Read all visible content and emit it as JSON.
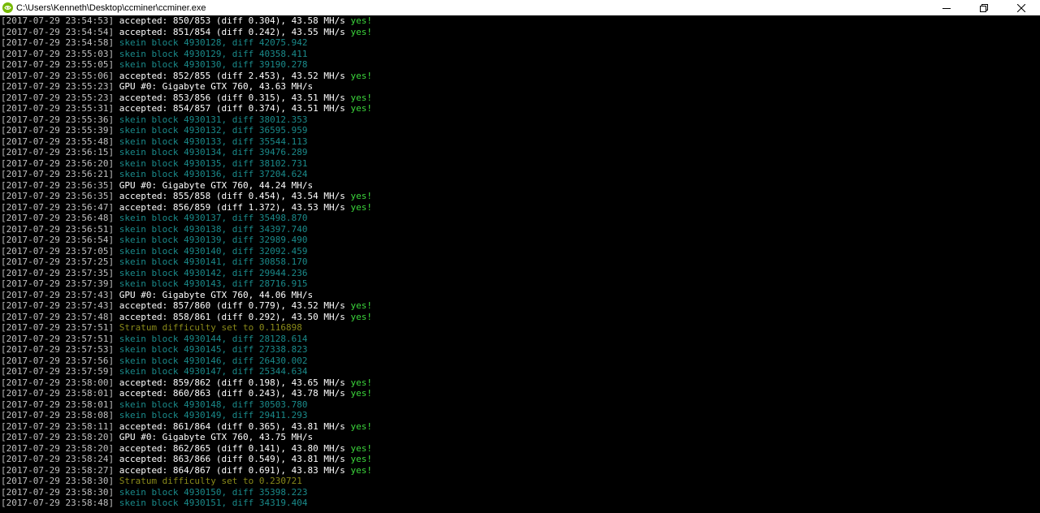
{
  "window": {
    "title": "C:\\Users\\Kenneth\\Desktop\\ccminer\\ccminer.exe"
  },
  "colors": {
    "accepted": "#ffffff",
    "block": "#1a8a8a",
    "gpu": "#ffffff",
    "stratum": "#8a8a1a",
    "yes": "#3cd73c",
    "timestamp": "#c0c0c0"
  },
  "icons": {
    "app": "nvidia-app-icon",
    "minimize": "minimize-icon",
    "restore": "restore-icon",
    "close": "close-icon"
  },
  "log": [
    {
      "ts": "[2017-07-29 23:54:53]",
      "type": "accepted",
      "text": "accepted: 850/853 (diff 0.304), 43.58 MH/s ",
      "yes": "yes!"
    },
    {
      "ts": "[2017-07-29 23:54:54]",
      "type": "accepted",
      "text": "accepted: 851/854 (diff 0.242), 43.55 MH/s ",
      "yes": "yes!"
    },
    {
      "ts": "[2017-07-29 23:54:58]",
      "type": "block",
      "text": "skein block 4930128, diff 42075.942"
    },
    {
      "ts": "[2017-07-29 23:55:03]",
      "type": "block",
      "text": "skein block 4930129, diff 40358.411"
    },
    {
      "ts": "[2017-07-29 23:55:05]",
      "type": "block",
      "text": "skein block 4930130, diff 39190.278"
    },
    {
      "ts": "[2017-07-29 23:55:06]",
      "type": "accepted",
      "text": "accepted: 852/855 (diff 2.453), 43.52 MH/s ",
      "yes": "yes!"
    },
    {
      "ts": "[2017-07-29 23:55:23]",
      "type": "gpu",
      "text": "GPU #0: Gigabyte GTX 760, 43.63 MH/s"
    },
    {
      "ts": "[2017-07-29 23:55:23]",
      "type": "accepted",
      "text": "accepted: 853/856 (diff 0.315), 43.51 MH/s ",
      "yes": "yes!"
    },
    {
      "ts": "[2017-07-29 23:55:31]",
      "type": "accepted",
      "text": "accepted: 854/857 (diff 0.374), 43.51 MH/s ",
      "yes": "yes!"
    },
    {
      "ts": "[2017-07-29 23:55:36]",
      "type": "block",
      "text": "skein block 4930131, diff 38012.353"
    },
    {
      "ts": "[2017-07-29 23:55:39]",
      "type": "block",
      "text": "skein block 4930132, diff 36595.959"
    },
    {
      "ts": "[2017-07-29 23:55:48]",
      "type": "block",
      "text": "skein block 4930133, diff 35544.113"
    },
    {
      "ts": "[2017-07-29 23:56:15]",
      "type": "block",
      "text": "skein block 4930134, diff 39476.289"
    },
    {
      "ts": "[2017-07-29 23:56:20]",
      "type": "block",
      "text": "skein block 4930135, diff 38102.731"
    },
    {
      "ts": "[2017-07-29 23:56:21]",
      "type": "block",
      "text": "skein block 4930136, diff 37204.624"
    },
    {
      "ts": "[2017-07-29 23:56:35]",
      "type": "gpu",
      "text": "GPU #0: Gigabyte GTX 760, 44.24 MH/s"
    },
    {
      "ts": "[2017-07-29 23:56:35]",
      "type": "accepted",
      "text": "accepted: 855/858 (diff 0.454), 43.54 MH/s ",
      "yes": "yes!"
    },
    {
      "ts": "[2017-07-29 23:56:47]",
      "type": "accepted",
      "text": "accepted: 856/859 (diff 1.372), 43.53 MH/s ",
      "yes": "yes!"
    },
    {
      "ts": "[2017-07-29 23:56:48]",
      "type": "block",
      "text": "skein block 4930137, diff 35498.870"
    },
    {
      "ts": "[2017-07-29 23:56:51]",
      "type": "block",
      "text": "skein block 4930138, diff 34397.740"
    },
    {
      "ts": "[2017-07-29 23:56:54]",
      "type": "block",
      "text": "skein block 4930139, diff 32989.490"
    },
    {
      "ts": "[2017-07-29 23:57:05]",
      "type": "block",
      "text": "skein block 4930140, diff 32092.459"
    },
    {
      "ts": "[2017-07-29 23:57:25]",
      "type": "block",
      "text": "skein block 4930141, diff 30858.170"
    },
    {
      "ts": "[2017-07-29 23:57:35]",
      "type": "block",
      "text": "skein block 4930142, diff 29944.236"
    },
    {
      "ts": "[2017-07-29 23:57:39]",
      "type": "block",
      "text": "skein block 4930143, diff 28716.915"
    },
    {
      "ts": "[2017-07-29 23:57:43]",
      "type": "gpu",
      "text": "GPU #0: Gigabyte GTX 760, 44.06 MH/s"
    },
    {
      "ts": "[2017-07-29 23:57:43]",
      "type": "accepted",
      "text": "accepted: 857/860 (diff 0.779), 43.52 MH/s ",
      "yes": "yes!"
    },
    {
      "ts": "[2017-07-29 23:57:48]",
      "type": "accepted",
      "text": "accepted: 858/861 (diff 0.292), 43.50 MH/s ",
      "yes": "yes!"
    },
    {
      "ts": "[2017-07-29 23:57:51]",
      "type": "stratum",
      "text": "Stratum difficulty set to 0.116898"
    },
    {
      "ts": "[2017-07-29 23:57:51]",
      "type": "block",
      "text": "skein block 4930144, diff 28128.614"
    },
    {
      "ts": "[2017-07-29 23:57:53]",
      "type": "block",
      "text": "skein block 4930145, diff 27338.823"
    },
    {
      "ts": "[2017-07-29 23:57:56]",
      "type": "block",
      "text": "skein block 4930146, diff 26430.002"
    },
    {
      "ts": "[2017-07-29 23:57:59]",
      "type": "block",
      "text": "skein block 4930147, diff 25344.634"
    },
    {
      "ts": "[2017-07-29 23:58:00]",
      "type": "accepted",
      "text": "accepted: 859/862 (diff 0.198), 43.65 MH/s ",
      "yes": "yes!"
    },
    {
      "ts": "[2017-07-29 23:58:01]",
      "type": "accepted",
      "text": "accepted: 860/863 (diff 0.243), 43.78 MH/s ",
      "yes": "yes!"
    },
    {
      "ts": "[2017-07-29 23:58:01]",
      "type": "block",
      "text": "skein block 4930148, diff 30503.780"
    },
    {
      "ts": "[2017-07-29 23:58:08]",
      "type": "block",
      "text": "skein block 4930149, diff 29411.293"
    },
    {
      "ts": "[2017-07-29 23:58:11]",
      "type": "accepted",
      "text": "accepted: 861/864 (diff 0.365), 43.81 MH/s ",
      "yes": "yes!"
    },
    {
      "ts": "[2017-07-29 23:58:20]",
      "type": "gpu",
      "text": "GPU #0: Gigabyte GTX 760, 43.75 MH/s"
    },
    {
      "ts": "[2017-07-29 23:58:20]",
      "type": "accepted",
      "text": "accepted: 862/865 (diff 0.141), 43.80 MH/s ",
      "yes": "yes!"
    },
    {
      "ts": "[2017-07-29 23:58:24]",
      "type": "accepted",
      "text": "accepted: 863/866 (diff 0.549), 43.81 MH/s ",
      "yes": "yes!"
    },
    {
      "ts": "[2017-07-29 23:58:27]",
      "type": "accepted",
      "text": "accepted: 864/867 (diff 0.691), 43.83 MH/s ",
      "yes": "yes!"
    },
    {
      "ts": "[2017-07-29 23:58:30]",
      "type": "stratum",
      "text": "Stratum difficulty set to 0.230721"
    },
    {
      "ts": "[2017-07-29 23:58:30]",
      "type": "block",
      "text": "skein block 4930150, diff 35398.223"
    },
    {
      "ts": "[2017-07-29 23:58:48]",
      "type": "block",
      "text": "skein block 4930151, diff 34319.404"
    }
  ]
}
